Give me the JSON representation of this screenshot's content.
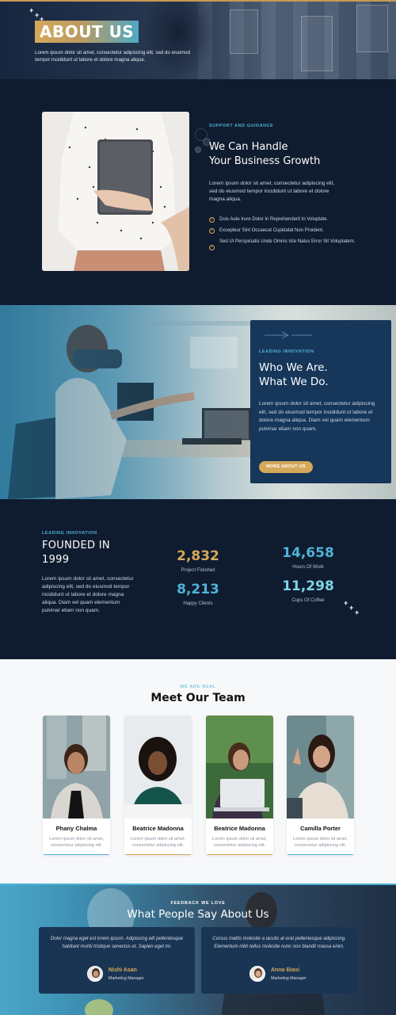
{
  "hero": {
    "title": "ABOUT US",
    "text": "Lorem ipsum dolor sit amet, consectetur adipiscing elit, sed do eiusmod tempor incididunt ut labore et dolore magna aliqua."
  },
  "support": {
    "eyebrow": "SUPPORT AND GUIDANCE",
    "heading_line1": "We Can Handle",
    "heading_line2": "Your Business Growth",
    "text": "Lorem ipsum dolor sit amet, consectetur adipiscing elit, sed do eiusmod tempor incididunt ut labore et dolore magna aliqua.",
    "checklist": [
      "Duis Aute Irure Dolor In Reprehenderit In Voluptate.",
      "Excepteur Sint Occaecat Cupidatat Non Proident.",
      "Sed Ut Perspiciatis Unde Omnis Iste Natus Error Sit Voluptatem."
    ]
  },
  "who": {
    "eyebrow": "LEADING INNOVATION",
    "heading_line1": "Who We Are.",
    "heading_line2": "What We Do.",
    "text": "Lorem ipsum dolor sit amet, consectetur adipiscing elit, sed do eiusmod tempor incididunt ut labore et dolore magna aliqua. Diam vel quam elementum pulvinar etiam non quam.",
    "button": "MORE ABOUT US"
  },
  "founded": {
    "eyebrow": "LEADING INNOVATION",
    "heading_line1": "FOUNDED IN",
    "heading_line2": "1999",
    "text": "Lorem ipsum dolor sit amet, consectetur adipiscing elit, sed do eiusmod tempor incididunt ut labore et dolore magna aliqua. Diam vel quam elementum pulvinar etiam non quam.",
    "stats": [
      {
        "value": "2,832",
        "label": "Project Finished",
        "color": "#d6a85a"
      },
      {
        "value": "14,658",
        "label": "Hours Of Work",
        "color": "#4fb3d6"
      },
      {
        "value": "8,213",
        "label": "Happy Clients",
        "color": "#4fb3d6"
      },
      {
        "value": "11,298",
        "label": "Cups Of Coffee",
        "color": "#7fd3e6"
      }
    ]
  },
  "team": {
    "eyebrow": "WE ARE REAL",
    "heading": "Meet Our Team",
    "members": [
      {
        "name": "Phany Chalma",
        "desc": "Lorem ipsum dolor sit amet, consectetur adipiscing elit."
      },
      {
        "name": "Beatrice Madonna",
        "desc": "Lorem ipsum dolor sit amet, consectetur adipiscing elit."
      },
      {
        "name": "Beatrice Madonna",
        "desc": "Lorem ipsum dolor sit amet, consectetur adipiscing elit."
      },
      {
        "name": "Camilla Porter",
        "desc": "Lorem ipsum dolor sit amet, consectetur adipiscing elit."
      }
    ]
  },
  "testimonials": {
    "eyebrow": "FEEDBACK WE LOVE",
    "heading": "What People Say About Us",
    "items": [
      {
        "quote": "Dolor magna eget est lorem ipsum. Adipiscing elit pellentesque habitant morbi tristique senectus et. Sapien eget mi.",
        "name": "Nishi Asan",
        "role": "Marketing Manager"
      },
      {
        "quote": "Cursus mattis molestie a iaculis at erat pellentesque adipiscing. Elementum nibh tellus molestie nunc non blandit massa enim.",
        "name": "Anna Biasi",
        "role": "Marketing Manager"
      }
    ]
  },
  "colors": {
    "navy": "#0f1b2e",
    "card_blue": "#16365a",
    "gold": "#d6a85a",
    "cyan": "#4fb3d6"
  }
}
